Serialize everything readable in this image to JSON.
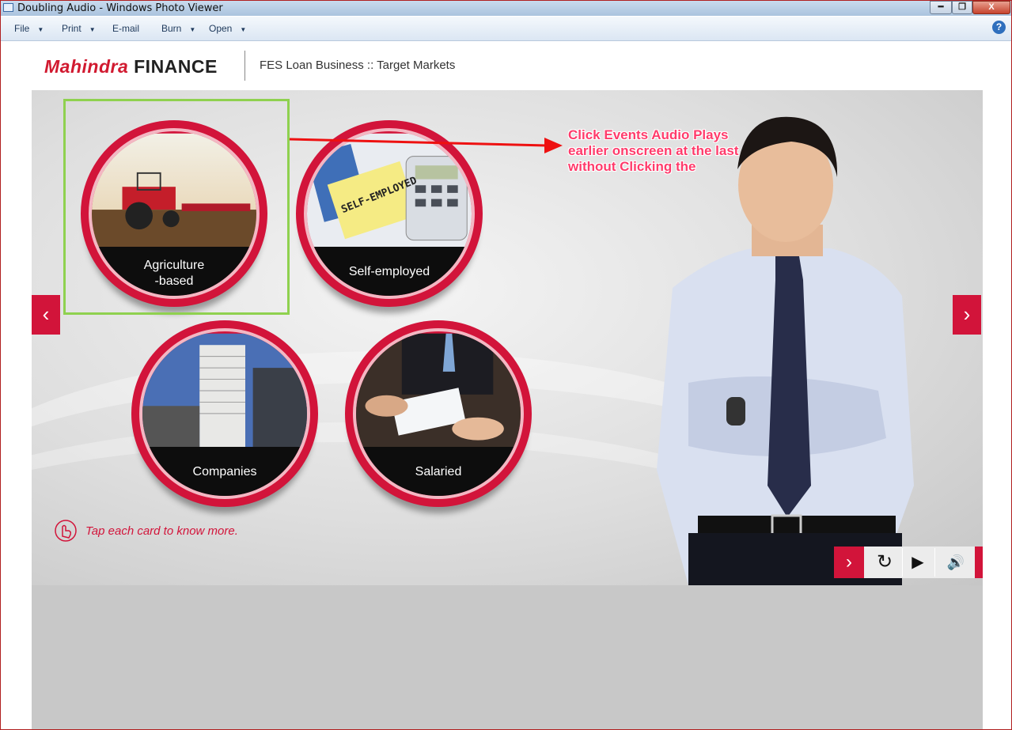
{
  "window": {
    "title": "Doubling Audio - Windows Photo Viewer",
    "min_label": "━",
    "max_label": "❐",
    "close_label": "X"
  },
  "menu": {
    "items": [
      {
        "label": "File"
      },
      {
        "label": "Print"
      },
      {
        "label": "E-mail"
      },
      {
        "label": "Burn"
      },
      {
        "label": "Open"
      }
    ],
    "help_label": "?"
  },
  "header": {
    "logo_mahindra": "Mahindra",
    "logo_finance": "FINANCE",
    "title": "FES Loan Business :: Target Markets"
  },
  "cards": [
    {
      "label": "Agriculture\n-based"
    },
    {
      "label": "Self-employed"
    },
    {
      "label": "Companies"
    },
    {
      "label": "Salaried"
    }
  ],
  "self_employed_note": "SELF-EMPLOYED",
  "annotation": "Click Events Audio Plays earlier onscreen at the last without Clicking the",
  "tap_hint": "Tap each card to know more.",
  "nav": {
    "prev": "‹",
    "next": "›"
  },
  "controls": {
    "next": "›",
    "replay": "↻",
    "play": "▶",
    "audio": "🔊"
  },
  "colors": {
    "brand_red": "#d2143a",
    "selection_green": "#8fd14f",
    "annotation_pink": "#ff3b6b"
  }
}
